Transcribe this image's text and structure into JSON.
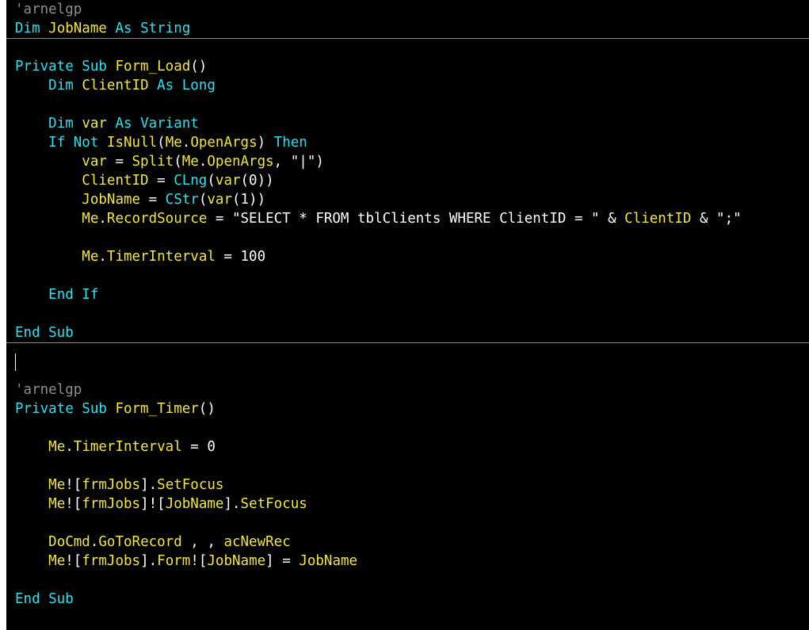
{
  "theme": {
    "background": "#000000",
    "keyword": "#2ee0f0",
    "identifier": "#f2e640",
    "plain": "#ffffff",
    "comment": "#8e8e8e"
  },
  "lines": [
    {
      "sep": false,
      "tokens": [
        {
          "t": "cm",
          "v": "'arnelgp"
        }
      ]
    },
    {
      "sep": true,
      "tokens": [
        {
          "t": "kw",
          "v": "Dim "
        },
        {
          "t": "id",
          "v": "JobName"
        },
        {
          "t": "kw",
          "v": " As String"
        }
      ]
    },
    {
      "sep": false,
      "tokens": []
    },
    {
      "sep": false,
      "tokens": [
        {
          "t": "kw",
          "v": "Private Sub "
        },
        {
          "t": "id",
          "v": "Form_Load"
        },
        {
          "t": "pl",
          "v": "()"
        }
      ]
    },
    {
      "sep": false,
      "tokens": [
        {
          "t": "pl",
          "v": "    "
        },
        {
          "t": "kw",
          "v": "Dim "
        },
        {
          "t": "id",
          "v": "ClientID"
        },
        {
          "t": "kw",
          "v": " As Long"
        }
      ]
    },
    {
      "sep": false,
      "tokens": []
    },
    {
      "sep": false,
      "tokens": [
        {
          "t": "pl",
          "v": "    "
        },
        {
          "t": "kw",
          "v": "Dim "
        },
        {
          "t": "id",
          "v": "var"
        },
        {
          "t": "kw",
          "v": " As Variant"
        }
      ]
    },
    {
      "sep": false,
      "tokens": [
        {
          "t": "pl",
          "v": "    "
        },
        {
          "t": "kw",
          "v": "If Not "
        },
        {
          "t": "id",
          "v": "IsNull"
        },
        {
          "t": "pl",
          "v": "("
        },
        {
          "t": "id",
          "v": "Me"
        },
        {
          "t": "pl",
          "v": "."
        },
        {
          "t": "id",
          "v": "OpenArgs"
        },
        {
          "t": "pl",
          "v": ") "
        },
        {
          "t": "kw",
          "v": "Then"
        }
      ]
    },
    {
      "sep": false,
      "tokens": [
        {
          "t": "pl",
          "v": "        "
        },
        {
          "t": "id",
          "v": "var"
        },
        {
          "t": "pl",
          "v": " = "
        },
        {
          "t": "id",
          "v": "Split"
        },
        {
          "t": "pl",
          "v": "("
        },
        {
          "t": "id",
          "v": "Me"
        },
        {
          "t": "pl",
          "v": "."
        },
        {
          "t": "id",
          "v": "OpenArgs"
        },
        {
          "t": "pl",
          "v": ", \"|\")"
        }
      ]
    },
    {
      "sep": false,
      "tokens": [
        {
          "t": "pl",
          "v": "        "
        },
        {
          "t": "id",
          "v": "ClientID"
        },
        {
          "t": "pl",
          "v": " = "
        },
        {
          "t": "kw",
          "v": "CLng"
        },
        {
          "t": "pl",
          "v": "("
        },
        {
          "t": "id",
          "v": "var"
        },
        {
          "t": "pl",
          "v": "(0))"
        }
      ]
    },
    {
      "sep": false,
      "tokens": [
        {
          "t": "pl",
          "v": "        "
        },
        {
          "t": "id",
          "v": "JobName"
        },
        {
          "t": "pl",
          "v": " = "
        },
        {
          "t": "kw",
          "v": "CStr"
        },
        {
          "t": "pl",
          "v": "("
        },
        {
          "t": "id",
          "v": "var"
        },
        {
          "t": "pl",
          "v": "(1))"
        }
      ]
    },
    {
      "sep": false,
      "tokens": [
        {
          "t": "pl",
          "v": "        "
        },
        {
          "t": "id",
          "v": "Me"
        },
        {
          "t": "pl",
          "v": "."
        },
        {
          "t": "id",
          "v": "RecordSource"
        },
        {
          "t": "pl",
          "v": " = \"SELECT * FROM tblClients WHERE ClientID = \" & "
        },
        {
          "t": "id",
          "v": "ClientID"
        },
        {
          "t": "pl",
          "v": " & \";\""
        }
      ]
    },
    {
      "sep": false,
      "tokens": []
    },
    {
      "sep": false,
      "tokens": [
        {
          "t": "pl",
          "v": "        "
        },
        {
          "t": "id",
          "v": "Me"
        },
        {
          "t": "pl",
          "v": "."
        },
        {
          "t": "id",
          "v": "TimerInterval"
        },
        {
          "t": "pl",
          "v": " = 100"
        }
      ]
    },
    {
      "sep": false,
      "tokens": []
    },
    {
      "sep": false,
      "tokens": [
        {
          "t": "pl",
          "v": "    "
        },
        {
          "t": "kw",
          "v": "End If"
        }
      ]
    },
    {
      "sep": false,
      "tokens": []
    },
    {
      "sep": true,
      "tokens": [
        {
          "t": "kw",
          "v": "End Sub"
        }
      ]
    },
    {
      "sep": false,
      "tokens": []
    },
    {
      "sep": false,
      "tokens": []
    },
    {
      "sep": false,
      "tokens": [
        {
          "t": "cm",
          "v": "'arnelgp"
        }
      ]
    },
    {
      "sep": false,
      "tokens": [
        {
          "t": "kw",
          "v": "Private Sub "
        },
        {
          "t": "id",
          "v": "Form_Timer"
        },
        {
          "t": "pl",
          "v": "()"
        }
      ]
    },
    {
      "sep": false,
      "tokens": []
    },
    {
      "sep": false,
      "tokens": [
        {
          "t": "pl",
          "v": "    "
        },
        {
          "t": "id",
          "v": "Me"
        },
        {
          "t": "pl",
          "v": "."
        },
        {
          "t": "id",
          "v": "TimerInterval"
        },
        {
          "t": "pl",
          "v": " = 0"
        }
      ]
    },
    {
      "sep": false,
      "tokens": []
    },
    {
      "sep": false,
      "tokens": [
        {
          "t": "pl",
          "v": "    "
        },
        {
          "t": "id",
          "v": "Me"
        },
        {
          "t": "pl",
          "v": "!["
        },
        {
          "t": "id",
          "v": "frmJobs"
        },
        {
          "t": "pl",
          "v": "]."
        },
        {
          "t": "id",
          "v": "SetFocus"
        }
      ]
    },
    {
      "sep": false,
      "tokens": [
        {
          "t": "pl",
          "v": "    "
        },
        {
          "t": "id",
          "v": "Me"
        },
        {
          "t": "pl",
          "v": "!["
        },
        {
          "t": "id",
          "v": "frmJobs"
        },
        {
          "t": "pl",
          "v": "]!["
        },
        {
          "t": "id",
          "v": "JobName"
        },
        {
          "t": "pl",
          "v": "]."
        },
        {
          "t": "id",
          "v": "SetFocus"
        }
      ]
    },
    {
      "sep": false,
      "tokens": []
    },
    {
      "sep": false,
      "tokens": [
        {
          "t": "pl",
          "v": "    "
        },
        {
          "t": "id",
          "v": "DoCmd"
        },
        {
          "t": "pl",
          "v": "."
        },
        {
          "t": "id",
          "v": "GoToRecord"
        },
        {
          "t": "pl",
          "v": " , , "
        },
        {
          "t": "id",
          "v": "acNewRec"
        }
      ]
    },
    {
      "sep": false,
      "tokens": [
        {
          "t": "pl",
          "v": "    "
        },
        {
          "t": "id",
          "v": "Me"
        },
        {
          "t": "pl",
          "v": "!["
        },
        {
          "t": "id",
          "v": "frmJobs"
        },
        {
          "t": "pl",
          "v": "]."
        },
        {
          "t": "id",
          "v": "Form"
        },
        {
          "t": "pl",
          "v": "!["
        },
        {
          "t": "id",
          "v": "JobName"
        },
        {
          "t": "pl",
          "v": "] = "
        },
        {
          "t": "id",
          "v": "JobName"
        }
      ]
    },
    {
      "sep": false,
      "tokens": []
    },
    {
      "sep": false,
      "tokens": [
        {
          "t": "kw",
          "v": "End Sub"
        }
      ]
    }
  ]
}
